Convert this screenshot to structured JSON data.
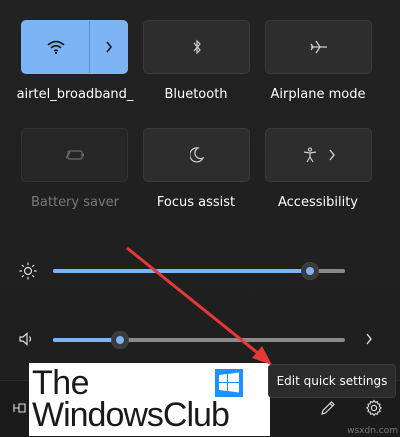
{
  "tiles": [
    {
      "label": "airtel_broadband_",
      "icon": "wifi-icon",
      "state": "active"
    },
    {
      "label": "Bluetooth",
      "icon": "bluetooth-icon",
      "state": "off"
    },
    {
      "label": "Airplane mode",
      "icon": "airplane-icon",
      "state": "off"
    },
    {
      "label": "Battery saver",
      "icon": "battery-saver-icon",
      "state": "disabled"
    },
    {
      "label": "Focus assist",
      "icon": "moon-icon",
      "state": "off"
    },
    {
      "label": "Accessibility",
      "icon": "accessibility-icon",
      "state": "off"
    }
  ],
  "brightness": {
    "icon": "brightness-icon",
    "level_percent": 88
  },
  "volume": {
    "icon": "speaker-icon",
    "level_percent": 23
  },
  "tooltip": {
    "text": "Edit quick settings"
  },
  "footer": {
    "edit_icon": "pencil-icon",
    "settings_icon": "gear-icon",
    "battery_icon": "plug-icon"
  },
  "logo": {
    "line1": "The",
    "line2": "WindowsClub"
  },
  "watermark": "wsxdn.com",
  "colors": {
    "accent": "#7cb4f5",
    "panel": "#202020",
    "tile": "#2d2d2d",
    "annotation_arrow": "#e53935"
  }
}
